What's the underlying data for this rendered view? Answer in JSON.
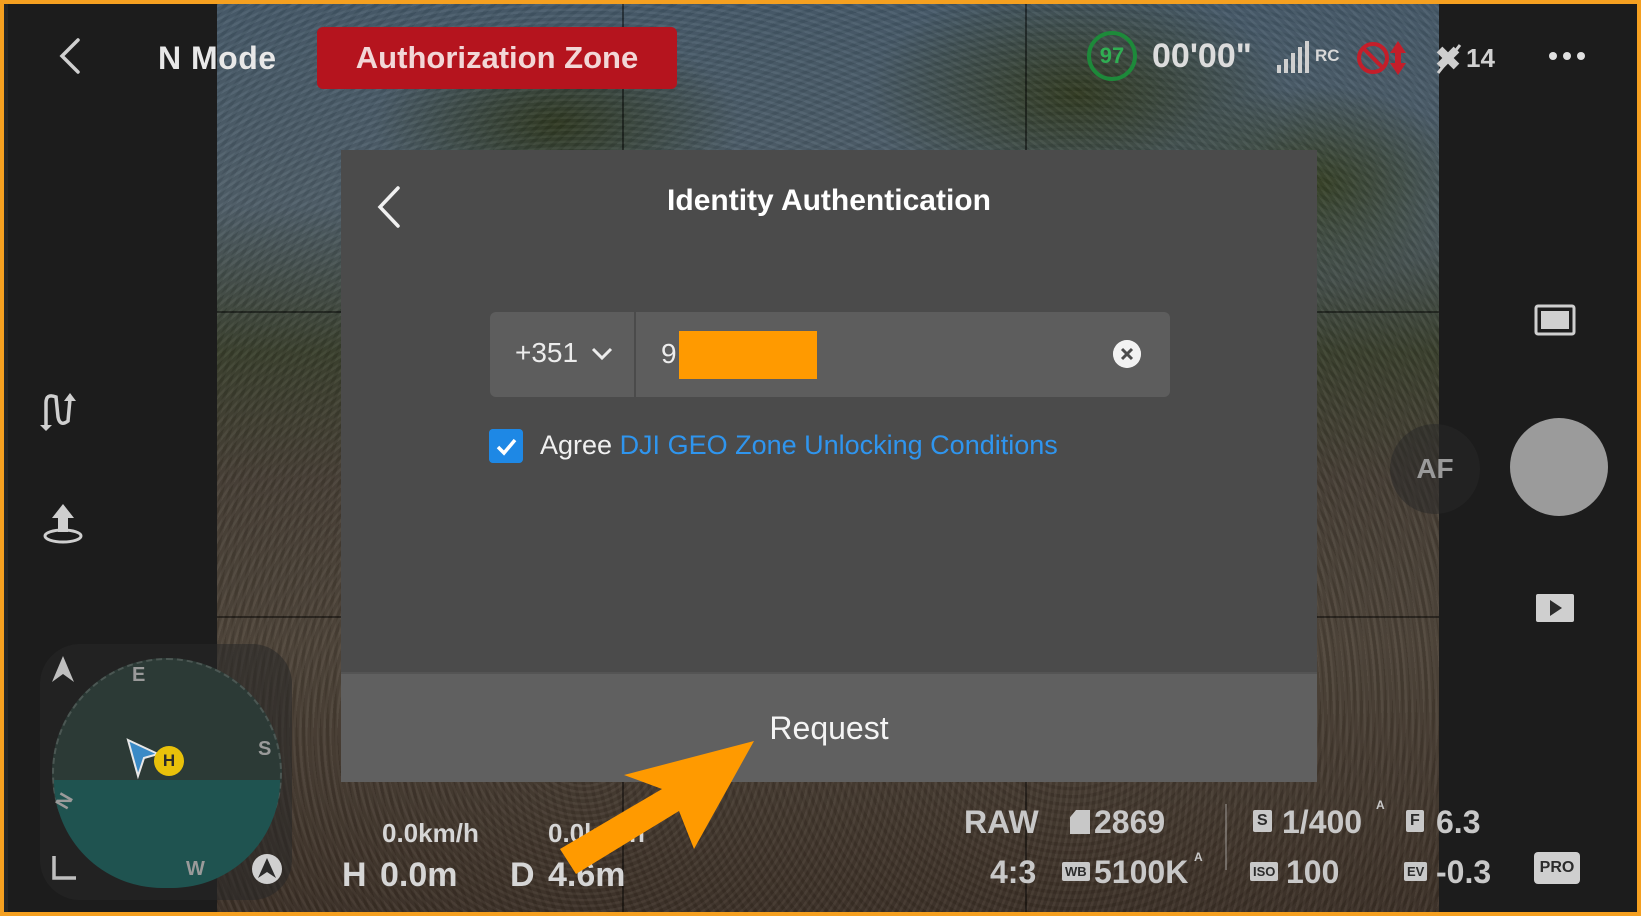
{
  "topbar": {
    "mode": "N Mode",
    "zone_badge": "Authorization Zone",
    "battery": "97",
    "timer": "00'00\"",
    "rc_label": "RC",
    "satellites": "14"
  },
  "dialog": {
    "title": "Identity Authentication",
    "country_code": "+351",
    "phone_value": "9",
    "agree_text": "Agree ",
    "agree_link": "DJI GEO Zone Unlocking Conditions",
    "agree_checked": true,
    "request_label": "Request"
  },
  "compass": {
    "e": "E",
    "s": "S",
    "w": "W",
    "n": "N",
    "home": "H"
  },
  "telemetry": {
    "h_speed": "0.0km/h",
    "v_speed": "0.0km/h",
    "height_label": "H",
    "height": "0.0m",
    "distance_label": "D",
    "distance": "4.6m"
  },
  "camera": {
    "format": "RAW",
    "storage": "2869",
    "ratio": "4:3",
    "wb_label": "WB",
    "wb": "5100K",
    "shutter_label": "S",
    "shutter": "1/400",
    "iso_label": "ISO",
    "iso": "100",
    "aperture_label": "F",
    "aperture": "6.3",
    "ev_label": "EV",
    "ev": "-0.3",
    "af": "AF",
    "pro": "PRO",
    "auto_mark": "A"
  },
  "colors": {
    "frame_border": "#f5a020",
    "zone_red": "#b5141e",
    "battery_green": "#2fae52",
    "link_blue": "#2f95ee",
    "checkbox_blue": "#1e88e5",
    "redaction_orange": "#ff9a00",
    "annotation_arrow": "#ff9a00"
  }
}
